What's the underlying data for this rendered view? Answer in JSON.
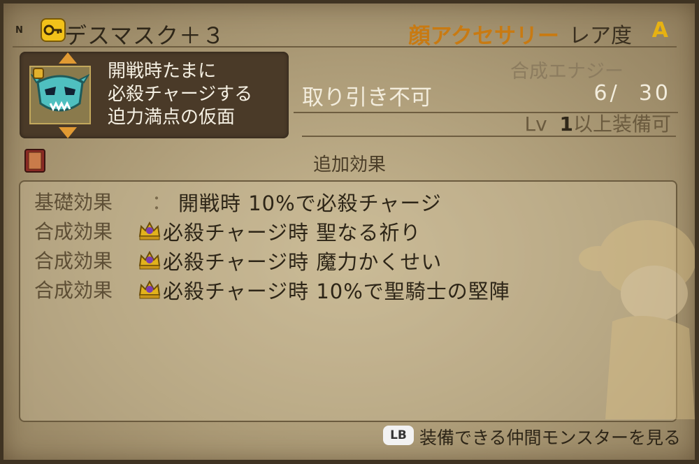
{
  "header": {
    "rank_mark": "N",
    "item_name": "デスマスク＋３",
    "category": "顔アクセサリー",
    "rarity_label": "レア度",
    "rarity_value": "A"
  },
  "description": {
    "lines": [
      "開戦時たまに",
      "必殺チャージする",
      "迫力満点の仮面"
    ]
  },
  "info": {
    "energy_label": "合成エナジー",
    "trade_status": "取り引き不可",
    "energy_value": "6/  30",
    "level_prefix": "Lv  ",
    "level_value": "1",
    "level_suffix": "以上装備可"
  },
  "extra": {
    "title": "追加効果"
  },
  "effects": [
    {
      "label": "基礎効果",
      "sep": "：",
      "text": "開戦時 10%で必殺チャージ",
      "icon": ""
    },
    {
      "label": "合成効果",
      "sep": "",
      "text": "必殺チャージ時 聖なる祈り",
      "icon": "crown-icon"
    },
    {
      "label": "合成効果",
      "sep": "",
      "text": "必殺チャージ時 魔力かくせい",
      "icon": "crown-icon"
    },
    {
      "label": "合成効果",
      "sep": "",
      "text": "必殺チャージ時 10%で聖騎士の堅陣",
      "icon": "crown-icon"
    }
  ],
  "footer": {
    "button": "LB",
    "text": "装備できる仲間モンスターを見る"
  },
  "colors": {
    "category": "#c87a12",
    "rarity": "#e7b212",
    "panel": "#4a3a28"
  }
}
